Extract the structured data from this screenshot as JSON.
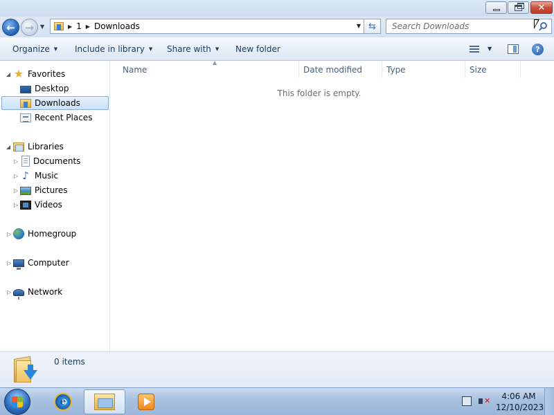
{
  "window": {
    "title_buttons": {
      "minimize": "minimize",
      "maximize": "restore",
      "close": "close"
    }
  },
  "navigation": {
    "back_icon": "back-arrow-icon",
    "forward_icon": "forward-arrow-icon",
    "breadcrumb": [
      "1",
      "Downloads"
    ]
  },
  "search": {
    "placeholder": "Search Downloads"
  },
  "commandbar": {
    "organize": "Organize",
    "include_in_library": "Include in library",
    "share_with": "Share with",
    "new_folder": "New folder",
    "help": "?"
  },
  "sidebar": {
    "favorites": {
      "label": "Favorites",
      "items": [
        {
          "label": "Desktop",
          "icon": "desktop-icon"
        },
        {
          "label": "Downloads",
          "icon": "downloads-folder-icon",
          "selected": true
        },
        {
          "label": "Recent Places",
          "icon": "recent-places-icon"
        }
      ]
    },
    "libraries": {
      "label": "Libraries",
      "items": [
        {
          "label": "Documents",
          "icon": "documents-icon"
        },
        {
          "label": "Music",
          "icon": "music-icon"
        },
        {
          "label": "Pictures",
          "icon": "pictures-icon"
        },
        {
          "label": "Videos",
          "icon": "videos-icon"
        }
      ]
    },
    "homegroup": {
      "label": "Homegroup"
    },
    "computer": {
      "label": "Computer"
    },
    "network": {
      "label": "Network"
    }
  },
  "content": {
    "columns": [
      "Name",
      "Date modified",
      "Type",
      "Size"
    ],
    "sort_column": "Name",
    "empty_message": "This folder is empty."
  },
  "details": {
    "count": "0 items"
  },
  "taskbar": {
    "pinned": [
      "internet-explorer-icon",
      "windows-explorer-icon",
      "windows-media-player-icon"
    ],
    "active": "windows-explorer-icon",
    "time": "4:06 AM",
    "date": "12/10/2023"
  },
  "colors": {
    "accent": "#1e395b",
    "selection": "#cce1fb",
    "muted_text": "#6d6d6d"
  }
}
